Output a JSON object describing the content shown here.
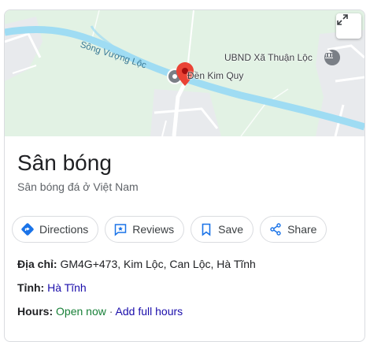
{
  "map": {
    "river_label": "Sông Vượng Lộc",
    "place_label": "Đền Kim Quy",
    "poi_label": "UBND Xã Thuận Lộc",
    "expand_icon": "expand-icon"
  },
  "place": {
    "name": "Sân bóng",
    "category": "Sân bóng đá ở Việt Nam"
  },
  "actions": [
    {
      "label": "Directions",
      "icon": "directions-icon"
    },
    {
      "label": "Reviews",
      "icon": "reviews-icon"
    },
    {
      "label": "Save",
      "icon": "bookmark-icon"
    },
    {
      "label": "Share",
      "icon": "share-icon"
    }
  ],
  "details": {
    "address_label": "Địa chỉ",
    "address_value": "GM4G+473, Kim Lộc, Can Lộc, Hà Tĩnh",
    "province_label": "Tỉnh",
    "province_value": "Hà Tĩnh",
    "hours_label": "Hours",
    "hours_status": "Open now",
    "hours_separator": "·",
    "hours_link": "Add full hours"
  },
  "colors": {
    "map_green": "#e2f2e4",
    "river": "#9fdcf3",
    "pin_red": "#ea4335",
    "link": "#1a0dab",
    "open_green": "#188038",
    "directions_blue": "#1a73e8"
  }
}
